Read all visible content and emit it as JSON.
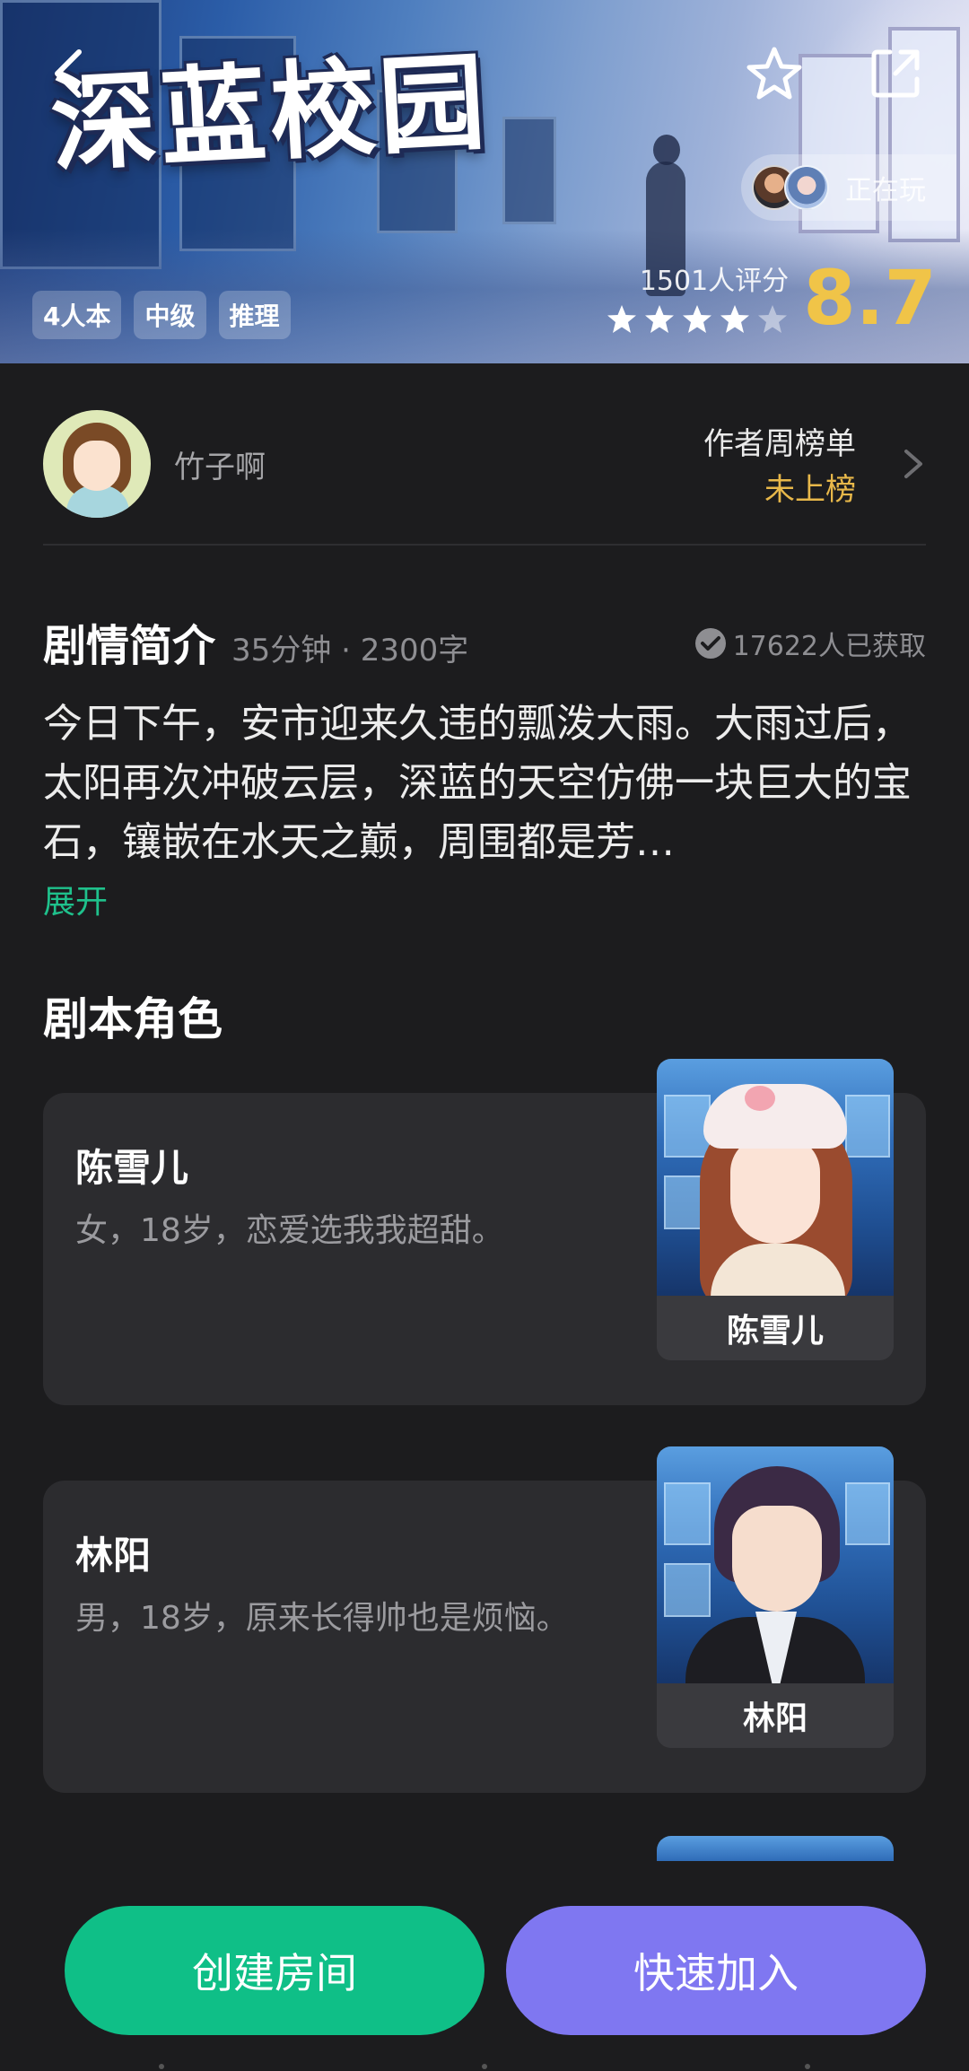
{
  "hero": {
    "title": "深蓝校园",
    "playing_label": "正在玩",
    "tags": [
      "4人本",
      "中级",
      "推理"
    ],
    "rating_count": "1501人评分",
    "rating_score": "8.7",
    "stars_filled": 4,
    "stars_total": 5
  },
  "author": {
    "name": "竹子啊",
    "rank_title": "作者周榜单",
    "rank_value": "未上榜"
  },
  "synopsis": {
    "title": "剧情简介",
    "meta": "35分钟 · 2300字",
    "obtained": "17622人已获取",
    "text": "今日下午，安市迎来久违的瓢泼大雨。大雨过后，太阳再次冲破云层，深蓝的天空仿佛一块巨大的宝石，镶嵌在水天之巅，周围都是芳…",
    "expand": "展开"
  },
  "roles": {
    "title": "剧本角色",
    "items": [
      {
        "name": "陈雪儿",
        "desc": "女，18岁，恋爱选我我超甜。",
        "portrait_label": "陈雪儿"
      },
      {
        "name": "林阳",
        "desc": "男，18岁，原来长得帅也是烦恼。",
        "portrait_label": "林阳"
      }
    ]
  },
  "actions": {
    "create": "创建房间",
    "join": "快速加入"
  },
  "colors": {
    "background": "#1c1c1e",
    "card": "#2c2c2f",
    "accent_green": "#0fbf87",
    "accent_purple": "#7f77f1",
    "score_gold": "#f0c448",
    "rank_gold": "#e8b84a",
    "link_green": "#1fc18c"
  },
  "icons": [
    "back-icon",
    "star-outline-icon",
    "share-icon",
    "chevron-right-icon",
    "check-circle-icon",
    "star-icon"
  ]
}
